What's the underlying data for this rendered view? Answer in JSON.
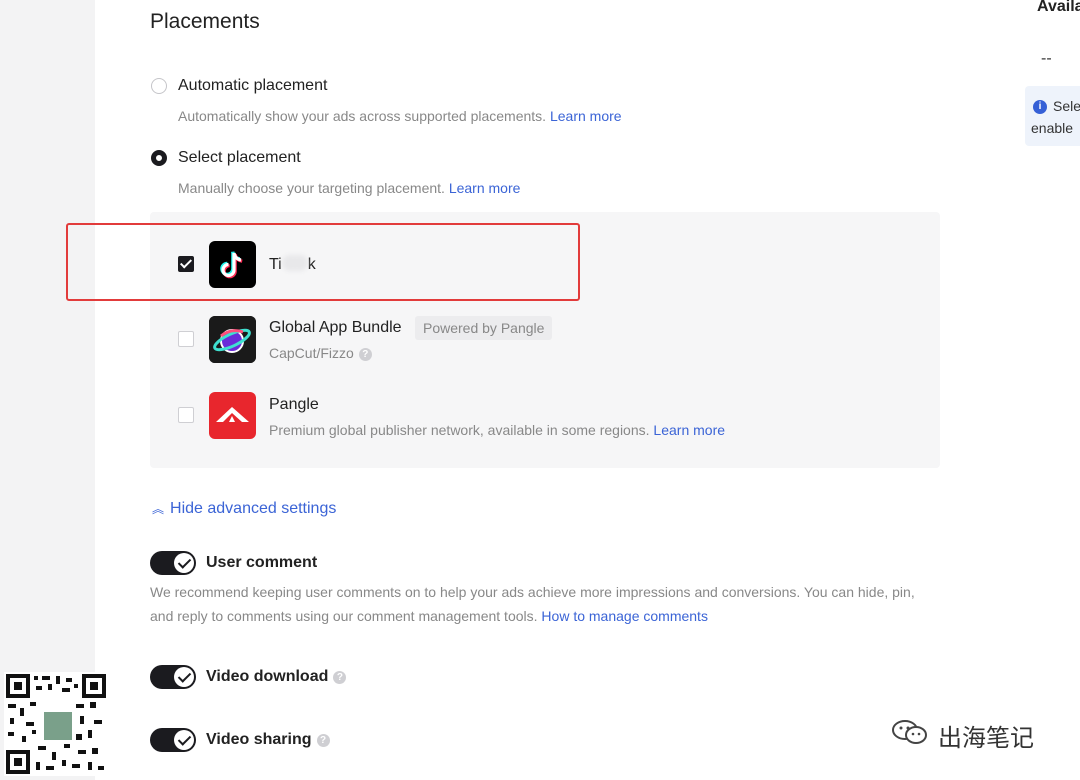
{
  "placements": {
    "title": "Placements",
    "automatic": {
      "label": "Automatic placement",
      "desc": "Automatically show your ads across supported placements.",
      "learn_more": "Learn more",
      "selected": false
    },
    "select": {
      "label": "Select placement",
      "desc": "Manually choose your targeting placement.",
      "learn_more": "Learn more",
      "selected": true
    },
    "apps": [
      {
        "name_start": "Ti",
        "name_end": "k",
        "checked": true
      },
      {
        "name": "Global App Bundle",
        "badge": "Powered by Pangle",
        "sub": "CapCut/Fizzo",
        "checked": false
      },
      {
        "name": "Pangle",
        "sub": "Premium global publisher network, available in some regions.",
        "learn_more": "Learn more",
        "checked": false
      }
    ],
    "advanced_link": "Hide advanced settings"
  },
  "settings": {
    "user_comment": {
      "label": "User comment",
      "desc_line1": "We recommend keeping user comments on to help your ads achieve more impressions and conversions. You can hide, pin,",
      "desc_line2": "and reply to comments using our comment management tools.",
      "link": "How to manage comments",
      "enabled": true
    },
    "video_download": {
      "label": "Video download",
      "enabled": true
    },
    "video_sharing": {
      "label": "Video sharing",
      "enabled": true
    }
  },
  "right_panel": {
    "title": "Availa",
    "value": "--",
    "info_line1": "Sele",
    "info_line2": "enable"
  },
  "branding": {
    "watermark_text": "出海笔记",
    "account_name": "出海笔记"
  },
  "colors": {
    "link": "#3b64d6",
    "highlight_border": "#e23b3b",
    "toggle_on": "#1b1b1f"
  }
}
